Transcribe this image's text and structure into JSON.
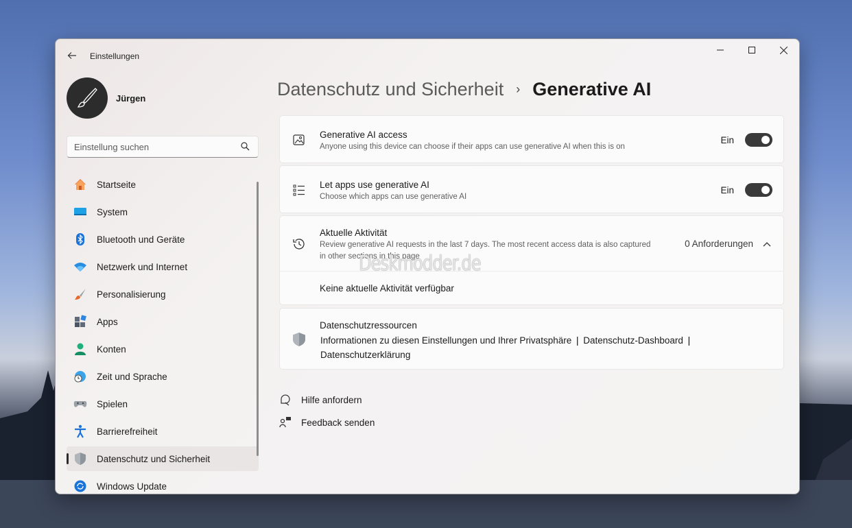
{
  "window": {
    "app_title": "Einstellungen"
  },
  "profile": {
    "name": "Jürgen"
  },
  "search": {
    "placeholder": "Einstellung suchen"
  },
  "sidebar": {
    "items": [
      {
        "label": "Startseite",
        "icon": "home-icon"
      },
      {
        "label": "System",
        "icon": "system-icon"
      },
      {
        "label": "Bluetooth und Geräte",
        "icon": "bluetooth-icon"
      },
      {
        "label": "Netzwerk und Internet",
        "icon": "wifi-icon"
      },
      {
        "label": "Personalisierung",
        "icon": "brush-icon"
      },
      {
        "label": "Apps",
        "icon": "apps-icon"
      },
      {
        "label": "Konten",
        "icon": "account-icon"
      },
      {
        "label": "Zeit und Sprache",
        "icon": "globe-clock-icon"
      },
      {
        "label": "Spielen",
        "icon": "gamepad-icon"
      },
      {
        "label": "Barrierefreiheit",
        "icon": "accessibility-icon"
      },
      {
        "label": "Datenschutz und Sicherheit",
        "icon": "shield-icon",
        "active": true
      },
      {
        "label": "Windows Update",
        "icon": "update-icon"
      }
    ]
  },
  "breadcrumb": {
    "parent": "Datenschutz und Sicherheit",
    "current": "Generative AI"
  },
  "cards": {
    "access": {
      "title": "Generative AI access",
      "desc": "Anyone using this device can choose if their apps can use generative AI when this is on",
      "state": "Ein"
    },
    "apps": {
      "title": "Let apps use generative AI",
      "desc": "Choose which apps can use generative AI",
      "state": "Ein"
    },
    "activity": {
      "title": "Aktuelle Aktivität",
      "desc_line1": "Review generative AI requests in the last 7 days. The most recent access data is also captured",
      "desc_line2": "in other sections in this page",
      "count": "0 Anforderungen",
      "empty": "Keine aktuelle Aktivität verfügbar"
    },
    "resources": {
      "title": "Datenschutzressourcen",
      "link1": "Informationen zu diesen Einstellungen und Ihrer Privatsphäre",
      "link2": "Datenschutz-Dashboard",
      "link3": "Datenschutzerklärung",
      "sep": "|"
    }
  },
  "footer": {
    "help": "Hilfe anfordern",
    "feedback": "Feedback senden"
  },
  "watermark": "Deskmodder.de"
}
